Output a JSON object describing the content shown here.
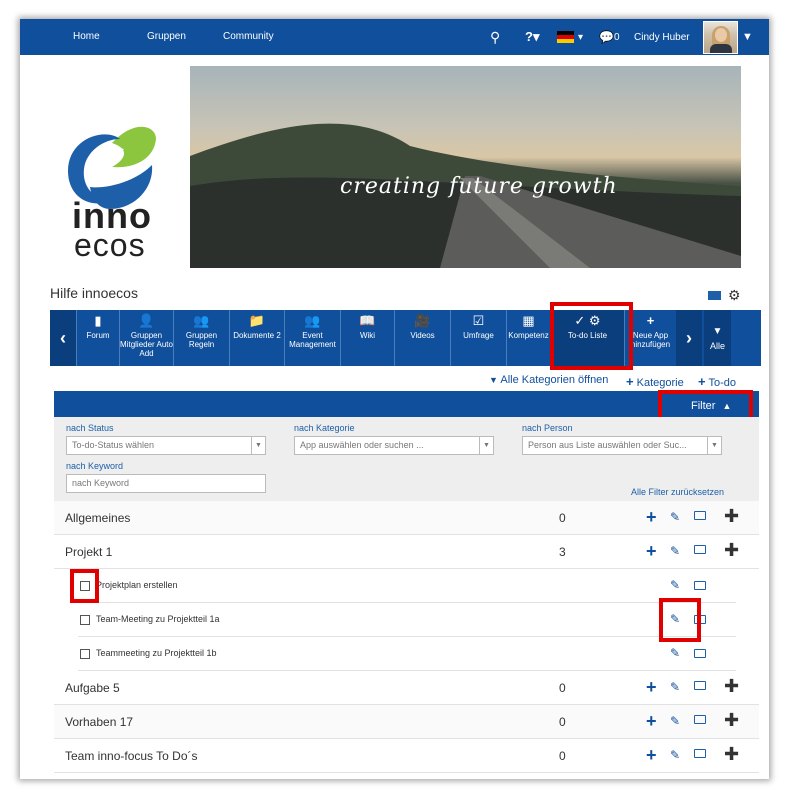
{
  "topnav": {
    "links": [
      "Home",
      "Gruppen",
      "Community"
    ],
    "chat_count": "0",
    "user_name": "Cindy Huber"
  },
  "logo": {
    "line1": "inno",
    "line2": "ecos"
  },
  "banner": {
    "text": "creating future growth"
  },
  "page": {
    "title": "Hilfe innoecos"
  },
  "apps": [
    {
      "label": "Forum",
      "icon": "forum-icon"
    },
    {
      "label": "Gruppen Mitglieder Auto Add",
      "icon": "add-user-icon"
    },
    {
      "label": "Gruppen Regeln",
      "icon": "group-icon"
    },
    {
      "label": "Dokumente 2",
      "icon": "folder-icon"
    },
    {
      "label": "Event Management",
      "icon": "people-icon"
    },
    {
      "label": "Wiki",
      "icon": "book-icon"
    },
    {
      "label": "Videos",
      "icon": "video-icon"
    },
    {
      "label": "Umfrage",
      "icon": "survey-icon"
    },
    {
      "label": "Kompetenz",
      "icon": "calendar-icon"
    },
    {
      "label": "To-do Liste",
      "icon": "check-icon"
    },
    {
      "label": "Neue App hinzufügen",
      "icon": "plus-icon"
    }
  ],
  "apps_all_label": "Alle",
  "actions": {
    "open_all": "Alle Kategorien öffnen",
    "category": "Kategorie",
    "todo": "To-do"
  },
  "filter": {
    "button": "Filter",
    "status_label": "nach Status",
    "status_placeholder": "To-do-Status wählen",
    "category_label": "nach Kategorie",
    "category_placeholder": "App auswählen oder suchen ...",
    "person_label": "nach Person",
    "person_placeholder": "Person aus Liste auswählen oder Suc...",
    "keyword_label": "nach Keyword",
    "keyword_placeholder": "nach Keyword",
    "reset": "Alle Filter zurücksetzen"
  },
  "categories": [
    {
      "name": "Allgemeines",
      "count": "0"
    },
    {
      "name": "Projekt 1",
      "count": "3"
    },
    {
      "name": "Aufgabe 5",
      "count": "0"
    },
    {
      "name": "Vorhaben 17",
      "count": "0"
    },
    {
      "name": "Team inno-focus To Do´s",
      "count": "0"
    }
  ],
  "todos": [
    {
      "label": "Projektplan erstellen"
    },
    {
      "label": "Team-Meeting zu Projektteil 1a"
    },
    {
      "label": "Teammeeting zu Projektteil 1b"
    }
  ],
  "colors": {
    "brand_blue": "#0f4f9b",
    "highlight_red": "#e00000"
  }
}
